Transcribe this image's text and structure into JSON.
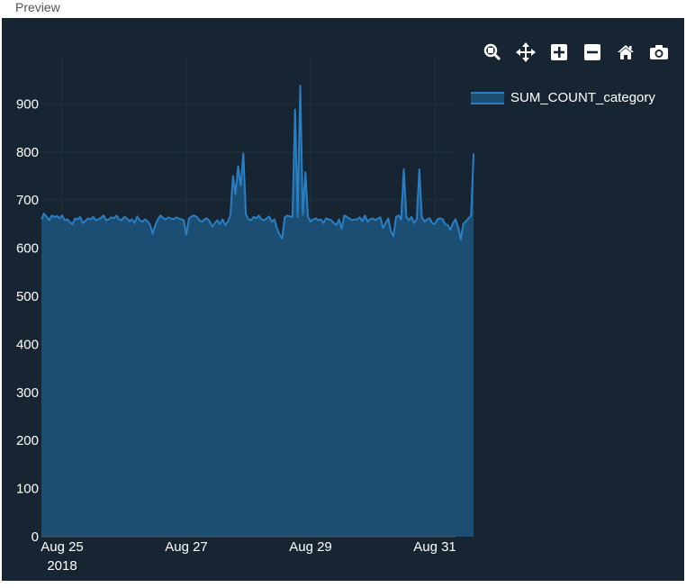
{
  "window": {
    "title": "Preview"
  },
  "modebar": [
    {
      "name": "zoom-icon",
      "active": true
    },
    {
      "name": "pan-icon",
      "active": false
    },
    {
      "name": "zoom-in-icon",
      "active": false
    },
    {
      "name": "zoom-out-icon",
      "active": false
    },
    {
      "name": "home-icon",
      "active": false
    },
    {
      "name": "camera-icon",
      "active": false
    }
  ],
  "colors": {
    "background": "#172532",
    "line": "#2a7fc4",
    "fill": "#1c4e74",
    "tick_text": "#ffffff",
    "grid": "#1f3140"
  },
  "chart_data": {
    "type": "area",
    "title": "",
    "xlabel": "",
    "ylabel": "",
    "ylim": [
      0,
      1000
    ],
    "yticks": [
      0,
      100,
      200,
      300,
      400,
      500,
      600,
      700,
      800,
      900
    ],
    "xticks": [
      {
        "label": "Aug 25",
        "sublabel": "2018",
        "x": "2018-08-25"
      },
      {
        "label": "Aug 27",
        "sublabel": "",
        "x": "2018-08-27"
      },
      {
        "label": "Aug 29",
        "sublabel": "",
        "x": "2018-08-29"
      },
      {
        "label": "Aug 31",
        "sublabel": "",
        "x": "2018-08-31"
      }
    ],
    "xlim": [
      "2018-08-24 16:00",
      "2018-08-31 08:00"
    ],
    "legend_position": "top-right",
    "series": [
      {
        "name": "SUM_COUNT_category",
        "x_start": "2018-08-24 16:00",
        "x_step_hours": 1,
        "values": [
          660,
          672,
          665,
          658,
          668,
          665,
          667,
          662,
          668,
          658,
          660,
          654,
          650,
          662,
          660,
          665,
          652,
          657,
          662,
          660,
          665,
          658,
          660,
          663,
          668,
          658,
          660,
          664,
          662,
          668,
          660,
          658,
          665,
          662,
          656,
          660,
          652,
          666,
          658,
          655,
          660,
          656,
          648,
          630,
          648,
          660,
          668,
          663,
          660,
          664,
          662,
          660,
          664,
          662,
          660,
          658,
          628,
          662,
          666,
          668,
          665,
          658,
          655,
          660,
          662,
          656,
          645,
          652,
          658,
          650,
          660,
          648,
          655,
          668,
          750,
          712,
          770,
          730,
          797,
          670,
          660,
          658,
          665,
          662,
          668,
          660,
          658,
          662,
          666,
          655,
          660,
          642,
          628,
          620,
          664,
          668,
          666,
          665,
          888,
          665,
          938,
          670,
          758,
          665,
          655,
          660,
          662,
          658,
          660,
          652,
          662,
          660,
          658,
          652,
          648,
          660,
          640,
          668,
          665,
          662,
          658,
          660,
          660,
          664,
          656,
          668,
          655,
          660,
          662,
          658,
          662,
          664,
          642,
          652,
          662,
          636,
          625,
          665,
          668,
          660,
          764,
          665,
          658,
          665,
          652,
          660,
          764,
          665,
          655,
          660,
          662,
          652,
          650,
          660,
          662,
          660,
          650,
          648,
          638,
          652,
          660,
          644,
          618,
          650,
          656,
          662,
          668,
          797
        ]
      }
    ]
  }
}
